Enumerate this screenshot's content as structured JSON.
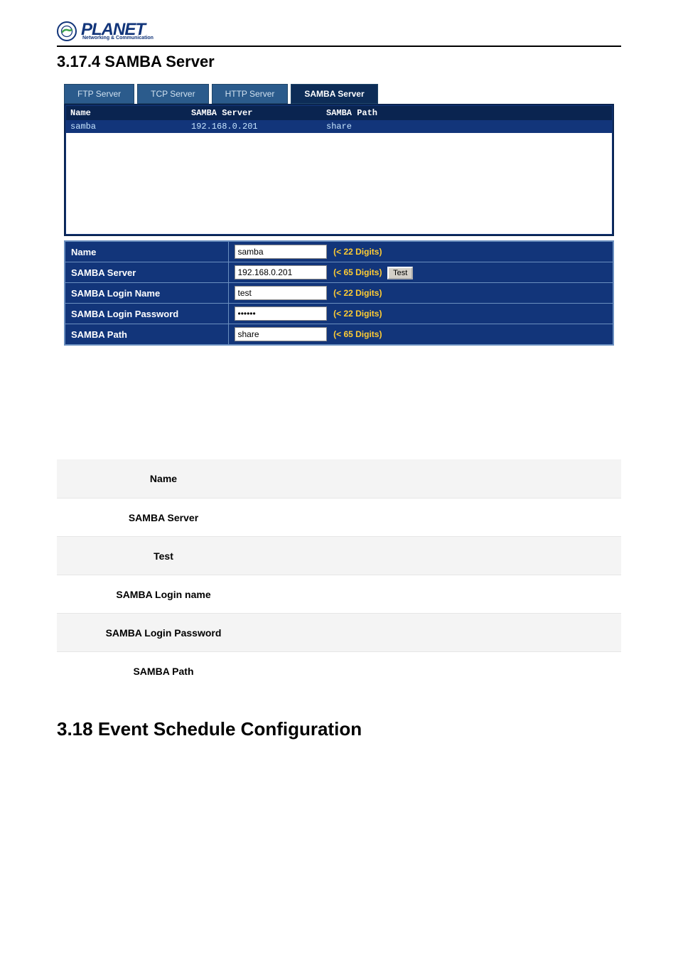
{
  "header": {
    "logo_text": "PLANET",
    "logo_sub": "Networking & Communication"
  },
  "section_title_1": "3.17.4 SAMBA Server",
  "tabs": {
    "items": [
      {
        "label": "FTP Server",
        "active": false
      },
      {
        "label": "TCP Server",
        "active": false
      },
      {
        "label": "HTTP Server",
        "active": false
      },
      {
        "label": "SAMBA Server",
        "active": true
      }
    ]
  },
  "list": {
    "headers": {
      "col1": "Name",
      "col2": "SAMBA Server",
      "col3": "SAMBA Path"
    },
    "rows": [
      {
        "col1": "samba",
        "col2": "192.168.0.201",
        "col3": "share"
      }
    ]
  },
  "form": {
    "rows": [
      {
        "label": "Name",
        "value": "samba",
        "hint": "(< 22 Digits)",
        "type": "text",
        "test": false
      },
      {
        "label": "SAMBA Server",
        "value": "192.168.0.201",
        "hint": "(< 65 Digits)",
        "type": "text",
        "test": true,
        "test_label": "Test"
      },
      {
        "label": "SAMBA Login Name",
        "value": "test",
        "hint": "(< 22 Digits)",
        "type": "text",
        "test": false
      },
      {
        "label": "SAMBA Login Password",
        "value": "••••••",
        "hint": "(< 22 Digits)",
        "type": "password",
        "test": false
      },
      {
        "label": "SAMBA Path",
        "value": "share",
        "hint": "(< 65 Digits)",
        "type": "text",
        "test": false
      }
    ]
  },
  "descriptions": [
    {
      "label": "Name",
      "shade": true
    },
    {
      "label": "SAMBA Server",
      "shade": false
    },
    {
      "label": "Test",
      "shade": true
    },
    {
      "label": "SAMBA Login name",
      "shade": false
    },
    {
      "label": "SAMBA Login Password",
      "shade": true
    },
    {
      "label": "SAMBA Path",
      "shade": false
    }
  ],
  "section_title_2": "3.18 Event Schedule Configuration"
}
